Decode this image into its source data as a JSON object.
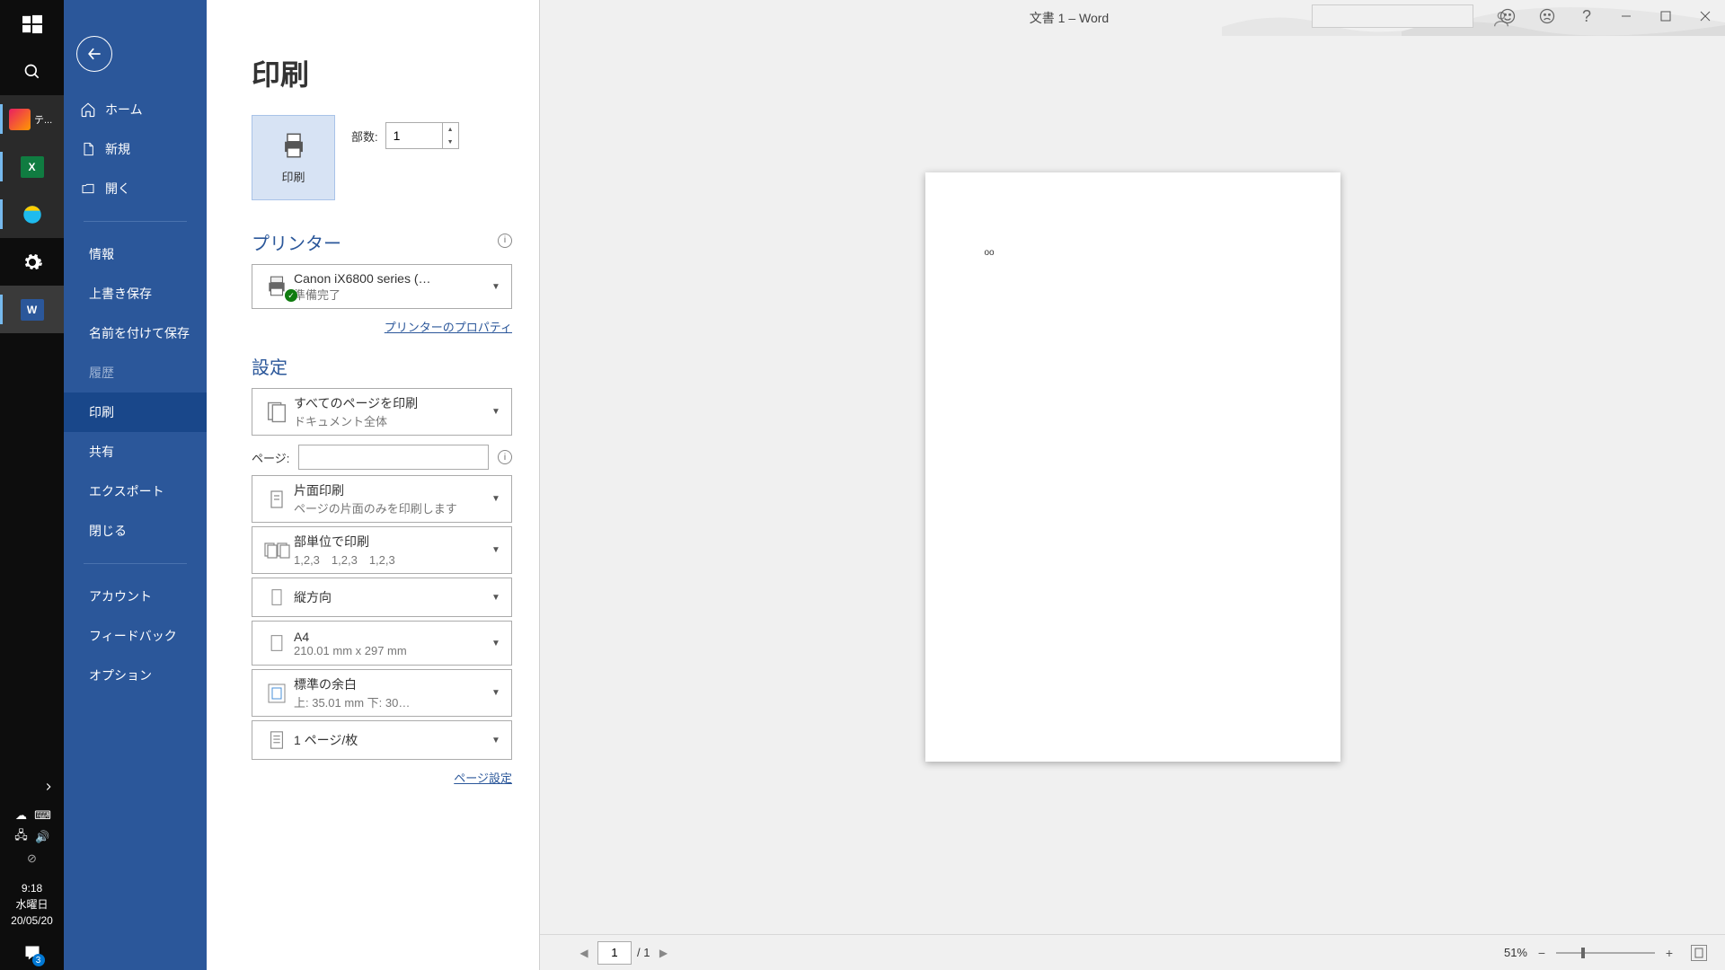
{
  "titlebar": {
    "title": "文書 1  –  Word",
    "search_placeholder": ""
  },
  "taskbar_clock": {
    "time": "9:18",
    "day": "水曜日",
    "date": "20/05/20",
    "notif_count": "3"
  },
  "apps": {
    "label_text_editor": "テ..."
  },
  "backstage": {
    "items": {
      "home": "ホーム",
      "new": "新規",
      "open": "開く",
      "info": "情報",
      "save": "上書き保存",
      "saveas": "名前を付けて保存",
      "history": "履歴",
      "print": "印刷",
      "share": "共有",
      "export": "エクスポート",
      "close": "閉じる",
      "account": "アカウント",
      "feedback": "フィードバック",
      "options": "オプション"
    }
  },
  "print": {
    "page_title": "印刷",
    "print_button_label": "印刷",
    "copies_label": "部数:",
    "copies_value": "1",
    "printer_section": "プリンター",
    "printer_name": "Canon iX6800 series (…",
    "printer_status": "準備完了",
    "printer_properties": "プリンターのプロパティ",
    "settings_section": "設定",
    "allpages_main": "すべてのページを印刷",
    "allpages_sub": "ドキュメント全体",
    "pages_label": "ページ:",
    "pages_value": "",
    "sides_main": "片面印刷",
    "sides_sub": "ページの片面のみを印刷します",
    "collate_main": "部単位で印刷",
    "collate_sub": "1,2,3　1,2,3　1,2,3",
    "orientation_main": "縦方向",
    "paper_main": "A4",
    "paper_sub": "210.01 mm x 297 mm",
    "margin_main": "標準の余白",
    "margin_sub": "上: 35.01 mm 下: 30…",
    "sheets_main": "1 ページ/枚",
    "page_setup": "ページ設定"
  },
  "preview": {
    "content": "oo",
    "current_page": "1",
    "total_pages": "1",
    "zoom": "51%"
  }
}
